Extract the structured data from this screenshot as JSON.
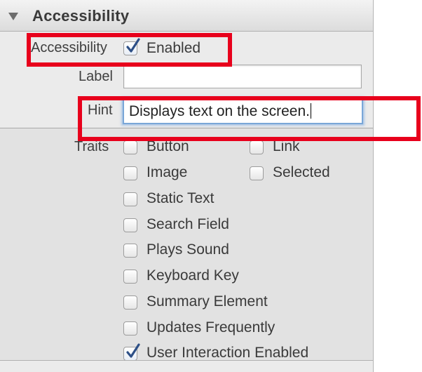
{
  "header": {
    "title": "Accessibility"
  },
  "accessibility": {
    "label": "Accessibility",
    "checkbox_label": "Enabled",
    "checked": true
  },
  "label_field": {
    "label": "Label",
    "value": ""
  },
  "hint_field": {
    "label": "Hint",
    "value": "Displays text on the screen."
  },
  "traits": {
    "label": "Traits",
    "left_column": [
      {
        "label": "Button",
        "checked": false
      },
      {
        "label": "Image",
        "checked": false
      },
      {
        "label": "Static Text",
        "checked": false
      },
      {
        "label": "Search Field",
        "checked": false
      },
      {
        "label": "Plays Sound",
        "checked": false
      },
      {
        "label": "Keyboard Key",
        "checked": false
      },
      {
        "label": "Summary Element",
        "checked": false
      },
      {
        "label": "Updates Frequently",
        "checked": false
      },
      {
        "label": "User Interaction Enabled",
        "checked": true
      }
    ],
    "right_column": [
      {
        "label": "Link",
        "checked": false
      },
      {
        "label": "Selected",
        "checked": false
      }
    ]
  },
  "colors": {
    "highlight": "#e8001c",
    "focus_ring": "#7aa7d8",
    "checkmark": "#2d4f86"
  }
}
